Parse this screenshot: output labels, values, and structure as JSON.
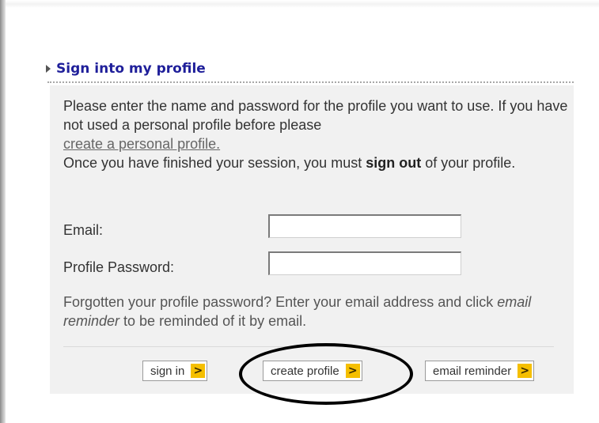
{
  "section": {
    "title": "Sign into my profile"
  },
  "intro": {
    "text1": "Please enter the name and password for the profile you want to use. If you have not used a personal profile before please",
    "link": "create a personal profile.",
    "text2": "Once you have finished your session, you must ",
    "bold": "sign out",
    "text3": " of your profile."
  },
  "form": {
    "email_label": "Email:",
    "email_value": "",
    "password_label": "Profile Password:",
    "password_value": ""
  },
  "help": {
    "text1": "Forgotten your profile password? Enter your email address and click ",
    "italic": "email reminder",
    "text2": " to be reminded of it by email."
  },
  "buttons": {
    "sign_in": "sign in",
    "create_profile": "create profile",
    "email_reminder": "email reminder",
    "arrow_glyph": ">"
  },
  "colors": {
    "title": "#1f1f9a",
    "panel": "#f1f1f1",
    "button_arrow": "#f5bf00",
    "highlight": "#000000"
  },
  "icons": {
    "section_arrow": "triangle-right-icon",
    "button_arrow": "chevron-right-icon"
  },
  "annotation": {
    "shape": "ellipse",
    "target": "create-profile-button"
  }
}
